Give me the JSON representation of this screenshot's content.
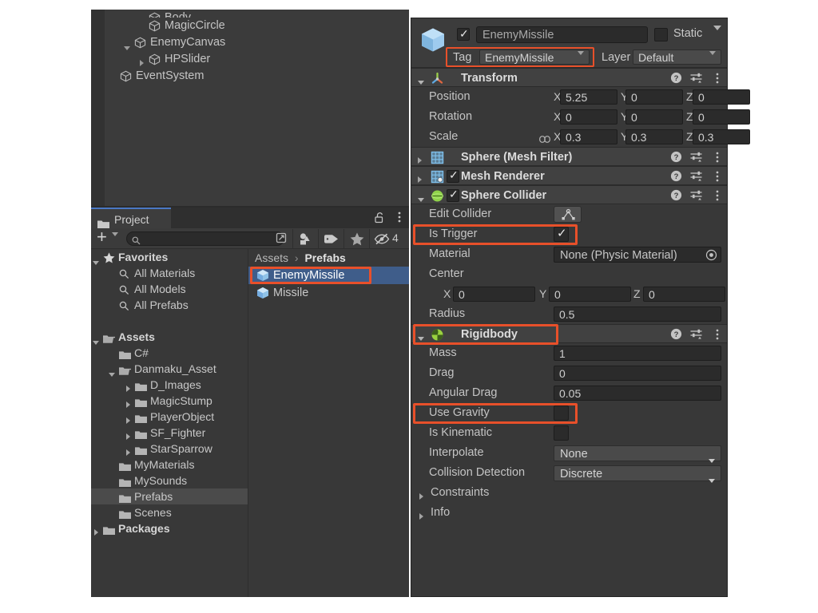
{
  "hierarchy": {
    "rows": [
      {
        "label": "Body",
        "indent": 3,
        "twisty": "none",
        "icon": "gameobject-cube-icon",
        "clipped": true
      },
      {
        "label": "MagicCircle",
        "indent": 3,
        "twisty": "none",
        "icon": "gameobject-cube-icon"
      },
      {
        "label": "EnemyCanvas",
        "indent": 2,
        "twisty": "expanded",
        "icon": "gameobject-cube-icon"
      },
      {
        "label": "HPSlider",
        "indent": 3,
        "twisty": "collapsed",
        "icon": "gameobject-cube-icon"
      },
      {
        "label": "EventSystem",
        "indent": 1,
        "twisty": "none",
        "icon": "gameobject-cube-icon"
      }
    ]
  },
  "project": {
    "tab_label": "Project",
    "tab_icon": "folder-icon",
    "lock_icon": "lock-open-icon",
    "kebab_icon": "kebab-menu-icon",
    "toolbar": {
      "add_label": "+",
      "add_icon": "plus-icon",
      "add_dropdown_icon": "chevron-down-icon",
      "search_icon": "search-icon",
      "search_value": "",
      "search_placeholder": "",
      "search_expand_icon": "expand-search-icon",
      "filter_type_icon": "filter-by-type-icon",
      "filter_label_icon": "filter-by-label-icon",
      "favorites_icon": "star-icon",
      "hidden_icon": "eye-slash-icon",
      "hidden_count": "4"
    },
    "tree": [
      {
        "label": "Favorites",
        "indent": 0,
        "twisty": "expanded",
        "icon": "star-icon",
        "bold": true,
        "selected": false
      },
      {
        "label": "All Materials",
        "indent": 1,
        "twisty": "none",
        "icon": "search-icon",
        "bold": false,
        "selected": false
      },
      {
        "label": "All Models",
        "indent": 1,
        "twisty": "none",
        "icon": "search-icon",
        "bold": false,
        "selected": false
      },
      {
        "label": "All Prefabs",
        "indent": 1,
        "twisty": "none",
        "icon": "search-icon",
        "bold": false,
        "selected": false
      },
      {
        "label": "",
        "indent": 0,
        "twisty": "none",
        "icon": "none",
        "bold": false,
        "selected": false
      },
      {
        "label": "Assets",
        "indent": 0,
        "twisty": "expanded",
        "icon": "folder-open-icon",
        "bold": true,
        "selected": false
      },
      {
        "label": "C#",
        "indent": 1,
        "twisty": "none",
        "icon": "folder-icon",
        "bold": false,
        "selected": false
      },
      {
        "label": "Danmaku_Asset",
        "indent": 1,
        "twisty": "expanded",
        "icon": "folder-open-icon",
        "bold": false,
        "selected": false
      },
      {
        "label": "D_Images",
        "indent": 2,
        "twisty": "collapsed",
        "icon": "folder-icon",
        "bold": false,
        "selected": false
      },
      {
        "label": "MagicStump",
        "indent": 2,
        "twisty": "collapsed",
        "icon": "folder-icon",
        "bold": false,
        "selected": false
      },
      {
        "label": "PlayerObject",
        "indent": 2,
        "twisty": "collapsed",
        "icon": "folder-icon",
        "bold": false,
        "selected": false
      },
      {
        "label": "SF_Fighter",
        "indent": 2,
        "twisty": "collapsed",
        "icon": "folder-icon",
        "bold": false,
        "selected": false
      },
      {
        "label": "StarSparrow",
        "indent": 2,
        "twisty": "collapsed",
        "icon": "folder-icon",
        "bold": false,
        "selected": false
      },
      {
        "label": "MyMaterials",
        "indent": 1,
        "twisty": "none",
        "icon": "folder-icon",
        "bold": false,
        "selected": false
      },
      {
        "label": "MySounds",
        "indent": 1,
        "twisty": "none",
        "icon": "folder-icon",
        "bold": false,
        "selected": false
      },
      {
        "label": "Prefabs",
        "indent": 1,
        "twisty": "none",
        "icon": "folder-icon",
        "bold": false,
        "selected": true
      },
      {
        "label": "Scenes",
        "indent": 1,
        "twisty": "none",
        "icon": "folder-icon",
        "bold": false,
        "selected": false
      },
      {
        "label": "Packages",
        "indent": 0,
        "twisty": "collapsed",
        "icon": "folder-icon",
        "bold": true,
        "selected": false
      }
    ],
    "breadcrumb": {
      "root": "Assets",
      "separator": "›",
      "current": "Prefabs"
    },
    "assets": [
      {
        "label": "EnemyMissile",
        "icon": "prefab-cube-icon",
        "selected": true,
        "annotated": true
      },
      {
        "label": "Missile",
        "icon": "prefab-cube-icon",
        "selected": false,
        "annotated": false
      }
    ]
  },
  "inspector": {
    "gameobject": {
      "icon": "prefab-cube-icon",
      "enabled_checkbox": "checked",
      "name": "EnemyMissile",
      "static_label": "Static",
      "static_checked": false,
      "static_dropdown_icon": "chevron-down-icon",
      "tag_label": "Tag",
      "tag_value": "EnemyMissile",
      "layer_label": "Layer",
      "layer_value": "Default"
    },
    "components": [
      {
        "name": "Transform",
        "icon": "transform-axis-icon",
        "foldout": "expanded",
        "has_enable_toggle": false,
        "help_icon": "help-icon",
        "preset_icon": "preset-icon",
        "kebab_icon": "kebab-menu-icon",
        "rows": [
          {
            "kind": "vector3",
            "label": "Position",
            "x": "5.25",
            "y": "0",
            "z": "0",
            "link": false
          },
          {
            "kind": "vector3",
            "label": "Rotation",
            "x": "0",
            "y": "0",
            "z": "0",
            "link": false
          },
          {
            "kind": "vector3",
            "label": "Scale",
            "x": "0.3",
            "y": "0.3",
            "z": "0.3",
            "link": true,
            "link_icon": "link-icon"
          }
        ]
      },
      {
        "name": "Sphere (Mesh Filter)",
        "icon": "mesh-filter-icon",
        "foldout": "collapsed",
        "has_enable_toggle": false,
        "help_icon": "help-icon",
        "preset_icon": "preset-icon",
        "kebab_icon": "kebab-menu-icon",
        "rows": []
      },
      {
        "name": "Mesh Renderer",
        "icon": "mesh-renderer-icon",
        "foldout": "collapsed",
        "has_enable_toggle": true,
        "enabled": true,
        "help_icon": "help-icon",
        "preset_icon": "preset-icon",
        "kebab_icon": "kebab-menu-icon",
        "rows": []
      },
      {
        "name": "Sphere Collider",
        "icon": "sphere-collider-icon",
        "foldout": "expanded",
        "has_enable_toggle": true,
        "enabled": true,
        "help_icon": "help-icon",
        "preset_icon": "preset-icon",
        "kebab_icon": "kebab-menu-icon",
        "rows": [
          {
            "kind": "button",
            "label": "Edit Collider",
            "button_icon": "edit-collider-icon"
          },
          {
            "kind": "checkbox",
            "label": "Is Trigger",
            "checked": true,
            "annotated": true
          },
          {
            "kind": "object",
            "label": "Material",
            "value": "None (Physic Material)",
            "picker_icon": "object-picker-icon"
          },
          {
            "kind": "text",
            "label": "Center"
          },
          {
            "kind": "vector3-indent",
            "label": "",
            "x": "0",
            "y": "0",
            "z": "0"
          },
          {
            "kind": "single",
            "label": "Radius",
            "value": "0.5"
          }
        ]
      },
      {
        "name": "Rigidbody",
        "icon": "rigidbody-icon",
        "foldout": "expanded",
        "has_enable_toggle": false,
        "annotated": true,
        "help_icon": "help-icon",
        "preset_icon": "preset-icon",
        "kebab_icon": "kebab-menu-icon",
        "rows": [
          {
            "kind": "single",
            "label": "Mass",
            "value": "1"
          },
          {
            "kind": "single",
            "label": "Drag",
            "value": "0"
          },
          {
            "kind": "single",
            "label": "Angular Drag",
            "value": "0.05"
          },
          {
            "kind": "checkbox",
            "label": "Use Gravity",
            "checked": false,
            "annotated": true
          },
          {
            "kind": "checkbox",
            "label": "Is Kinematic",
            "checked": false
          },
          {
            "kind": "dropdown",
            "label": "Interpolate",
            "value": "None"
          },
          {
            "kind": "dropdown",
            "label": "Collision Detection",
            "value": "Discrete"
          },
          {
            "kind": "foldout",
            "label": "Constraints",
            "state": "collapsed"
          },
          {
            "kind": "foldout",
            "label": "Info",
            "state": "collapsed"
          }
        ]
      }
    ]
  },
  "colors": {
    "annotation": "#e8502a",
    "selection_blue": "#3f5d8a",
    "tab_accent": "#4a77c4",
    "panel_bg": "#383838",
    "header_bg": "#414141"
  }
}
